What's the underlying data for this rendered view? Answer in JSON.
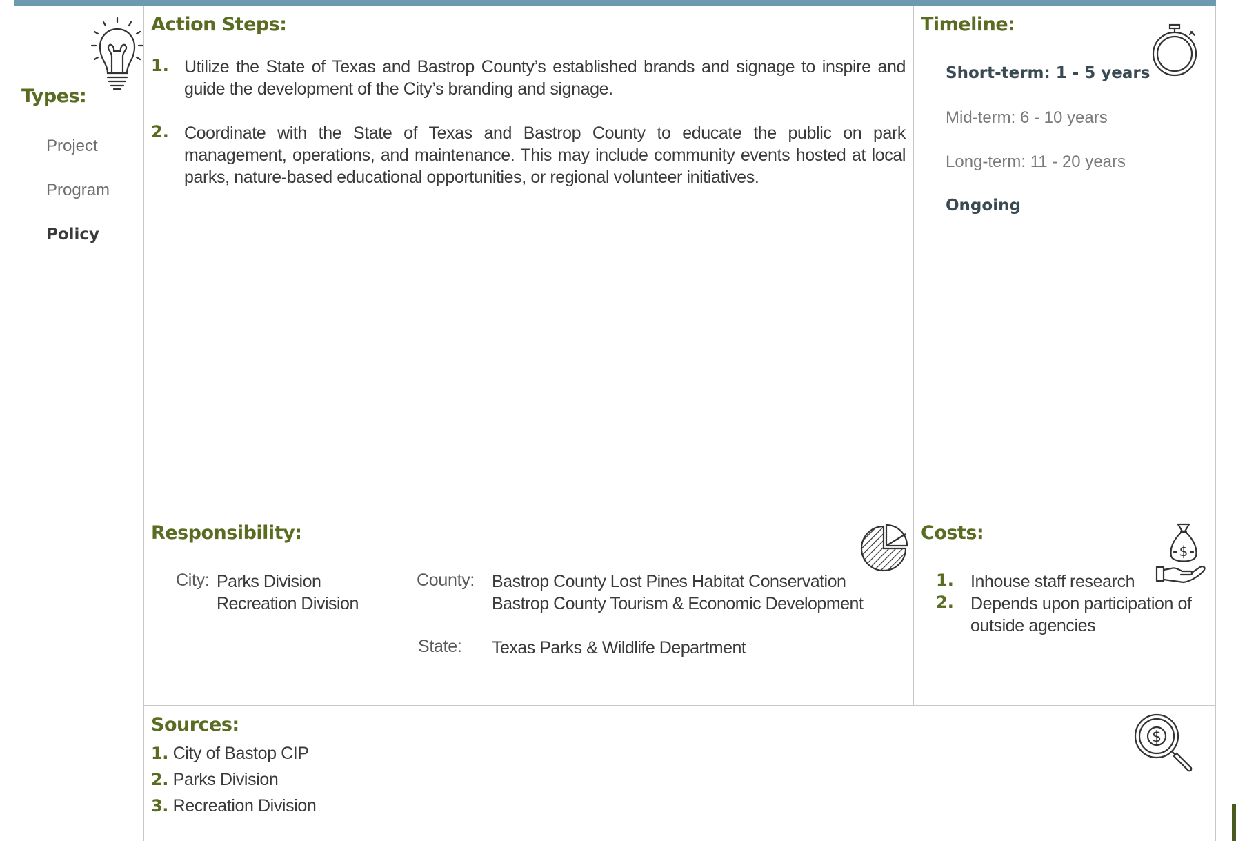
{
  "types": {
    "heading": "Types:",
    "items": [
      {
        "label": "Project"
      },
      {
        "label": "Program"
      },
      {
        "label": "Policy"
      }
    ]
  },
  "action_steps": {
    "heading": "Action Steps:",
    "items": [
      {
        "num": "1.",
        "text": "Utilize the State of Texas and Bastrop County’s established brands and signage to inspire and guide the development of the City’s branding and signage."
      },
      {
        "num": "2.",
        "text": "Coordinate with the State of Texas and Bastrop County to educate the public on park management, operations, and maintenance. This may include community events hosted at local parks, nature-based educational opportunities, or regional volunteer initiatives."
      }
    ]
  },
  "timeline": {
    "heading": "Timeline:",
    "items": [
      {
        "label": "Short-term:  1 - 5 years"
      },
      {
        "label": "Mid-term:  6 - 10 years"
      },
      {
        "label": "Long-term:  11 - 20 years"
      },
      {
        "label": "Ongoing"
      }
    ]
  },
  "responsibility": {
    "heading": "Responsibility:",
    "city_label": "City:",
    "city_values": [
      "Parks Division",
      "Recreation Division"
    ],
    "county_label": "County:",
    "county_values": [
      "Bastrop County Lost Pines Habitat Conservation",
      "Bastrop County Tourism & Economic Development"
    ],
    "state_label": "State:",
    "state_value": "Texas Parks & Wildlife Department"
  },
  "costs": {
    "heading": "Costs:",
    "items": [
      {
        "num": "1.",
        "text": "Inhouse staff research"
      },
      {
        "num": "2.",
        "text": "Depends upon participation of outside agencies"
      }
    ]
  },
  "sources": {
    "heading": "Sources:",
    "items": [
      {
        "num": "1.",
        "text": "City of Bastop CIP"
      },
      {
        "num": "2.",
        "text": "Parks Division"
      },
      {
        "num": "3.",
        "text": "Recreation Division"
      }
    ]
  },
  "icons": {
    "types": "lightbulb-icon",
    "timeline": "stopwatch-icon",
    "responsibility": "pie-chart-icon",
    "costs": "money-bag-hand-icon",
    "sources": "dollar-magnifier-icon"
  },
  "colors": {
    "heading": "#5a6b22",
    "top_bar": "#6b9bb0",
    "rule": "#c8c8c8"
  }
}
